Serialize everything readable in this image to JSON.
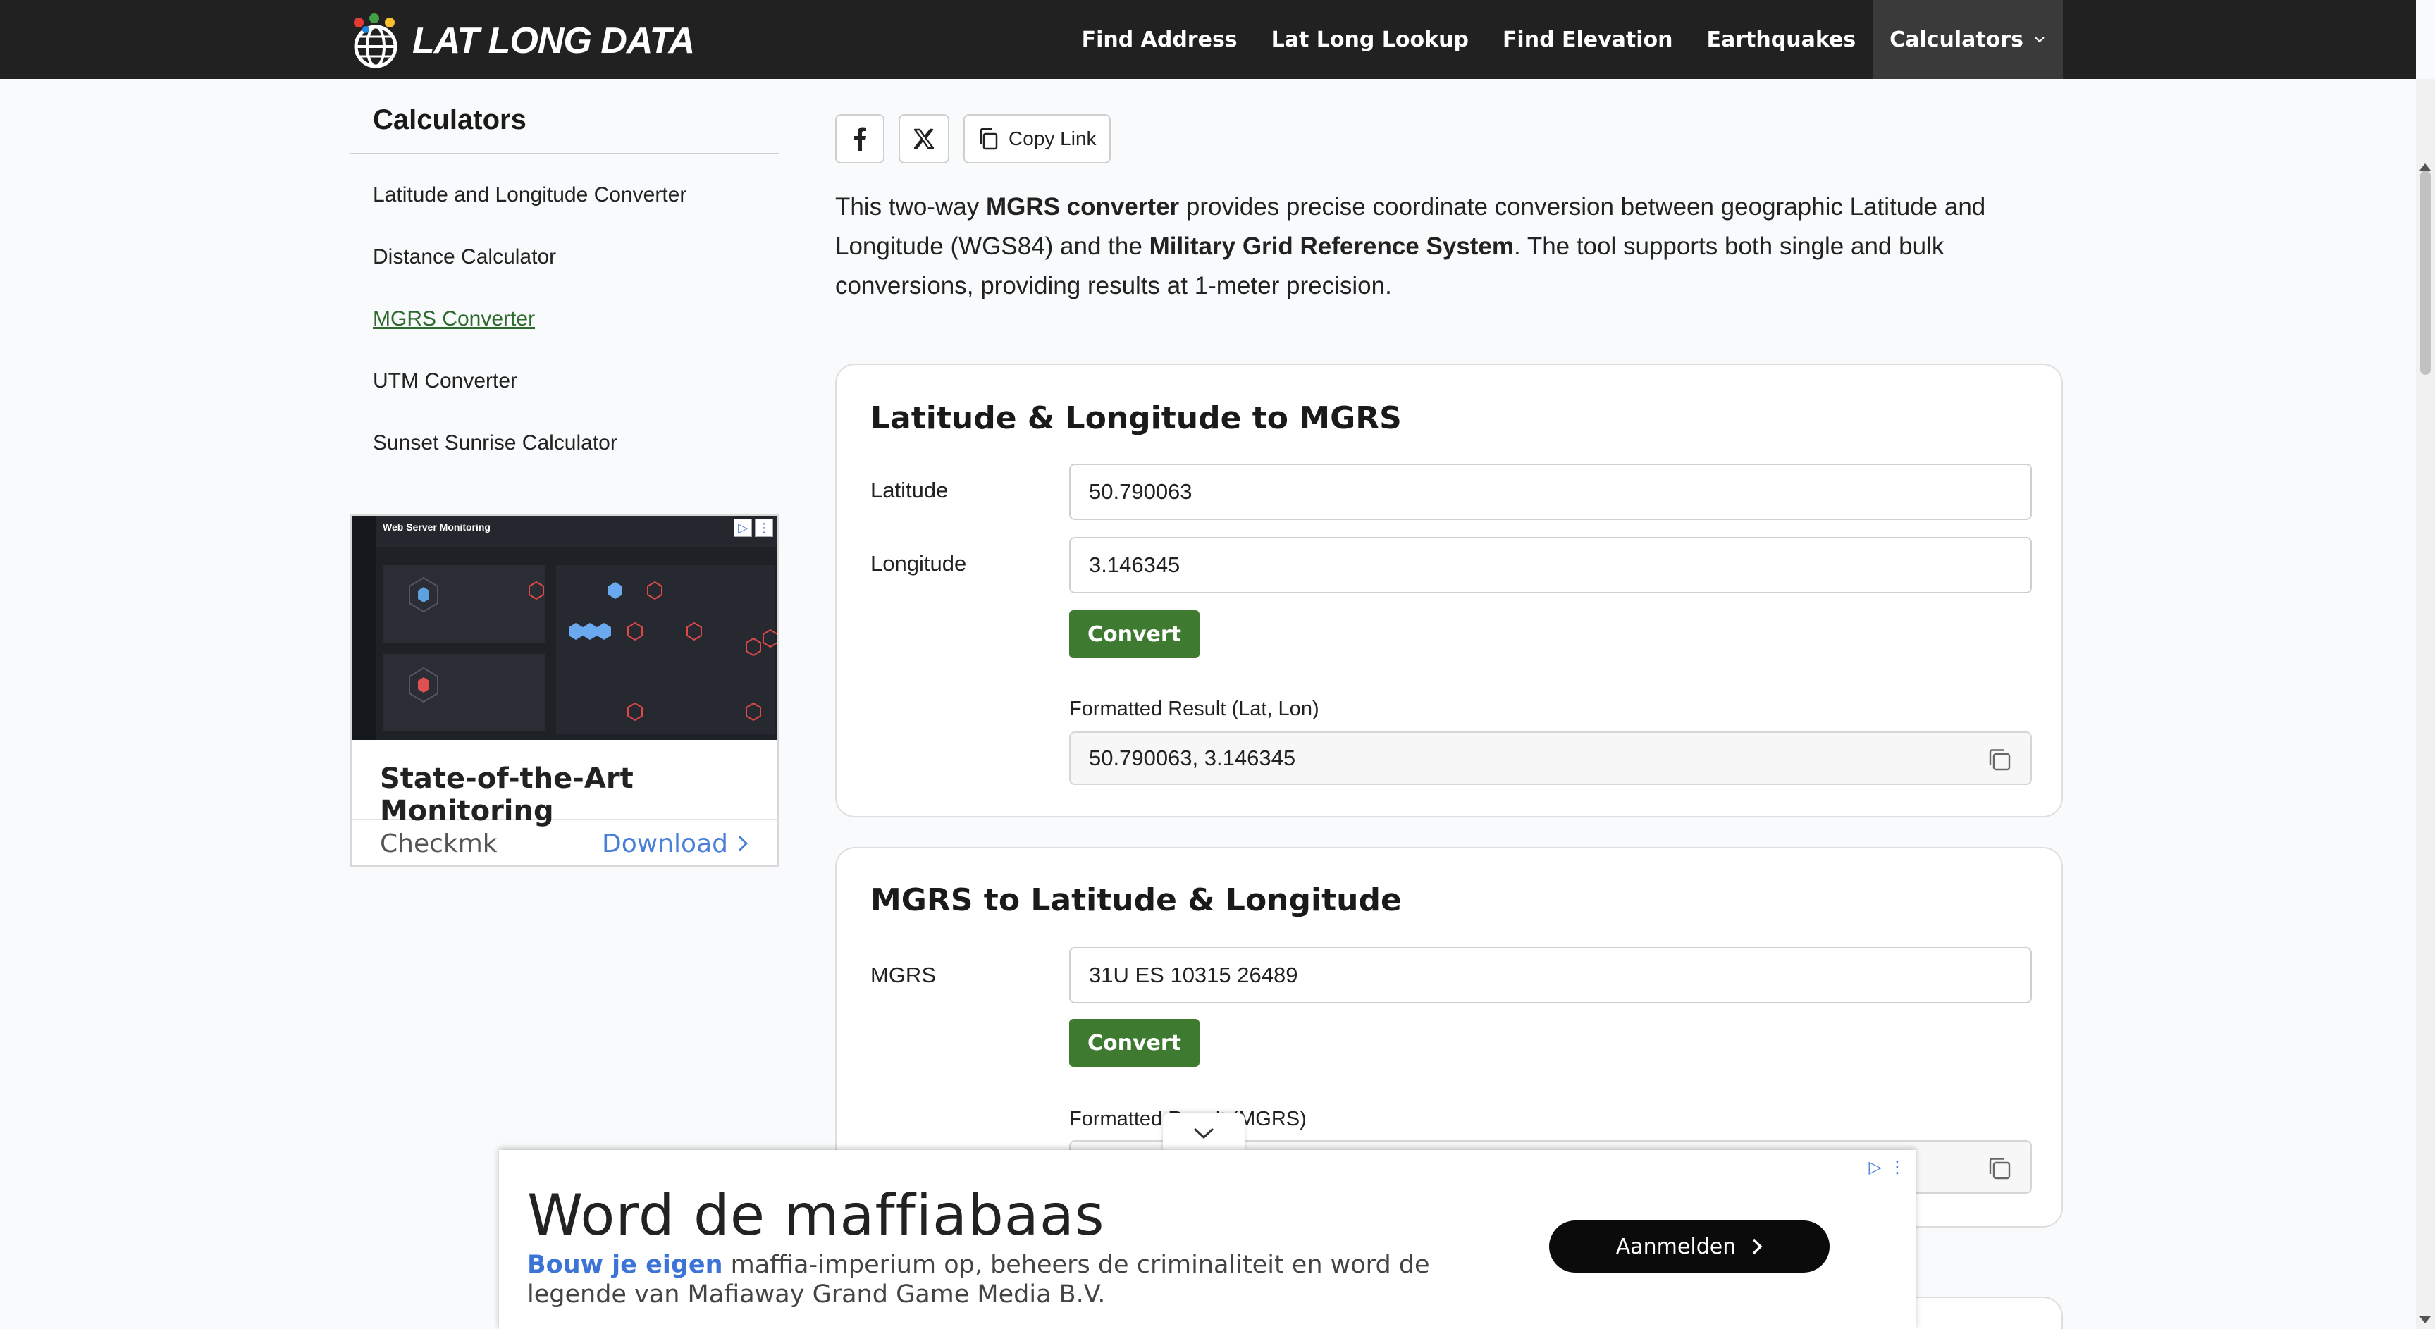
{
  "header": {
    "logo_text": "LAT LONG DATA",
    "nav": [
      {
        "label": "Find Address"
      },
      {
        "label": "Lat Long Lookup"
      },
      {
        "label": "Find Elevation"
      },
      {
        "label": "Earthquakes"
      },
      {
        "label": "Calculators"
      }
    ]
  },
  "sidebar": {
    "title": "Calculators",
    "items": [
      {
        "label": "Latitude and Longitude Converter"
      },
      {
        "label": "Distance Calculator"
      },
      {
        "label": "MGRS Converter"
      },
      {
        "label": "UTM Converter"
      },
      {
        "label": "Sunset Sunrise Calculator"
      }
    ],
    "ad": {
      "screenshot_title": "Web Server Monitoring",
      "title": "State-of-the-Art Monitoring",
      "brand": "Checkmk",
      "cta": "Download"
    }
  },
  "share": {
    "copy_link": "Copy Link"
  },
  "intro": {
    "p1": "This two-way ",
    "b1": "MGRS converter",
    "p2": " provides precise coordinate conversion between geographic Latitude and Longitude (WGS84) and the ",
    "b2": "Military Grid Reference System",
    "p3": ". The tool supports both single and bulk conversions, providing results at 1-meter precision."
  },
  "card1": {
    "title": "Latitude & Longitude to MGRS",
    "lat_label": "Latitude",
    "lat_value": "50.790063",
    "lon_label": "Longitude",
    "lon_value": "3.146345",
    "convert_label": "Convert",
    "result_label": "Formatted Result (Lat, Lon)",
    "result_value": "50.790063, 3.146345"
  },
  "card2": {
    "title": "MGRS to Latitude & Longitude",
    "mgrs_label": "MGRS",
    "mgrs_value": "31U ES 10315 26489",
    "convert_label": "Convert",
    "result_label": "Formatted Result (MGRS)"
  },
  "bottom_ad": {
    "headline": "Word de maffiabaas",
    "highlight": "Bouw je eigen",
    "text": " maffia-imperium op, beheers de criminaliteit en word de legende van Mafiaway Grand Game Media B.V.",
    "button": "Aanmelden"
  },
  "colors": {
    "nav_bg": "#212121",
    "accent_green": "#3e7a30",
    "link_blue": "#4a7fd9"
  }
}
